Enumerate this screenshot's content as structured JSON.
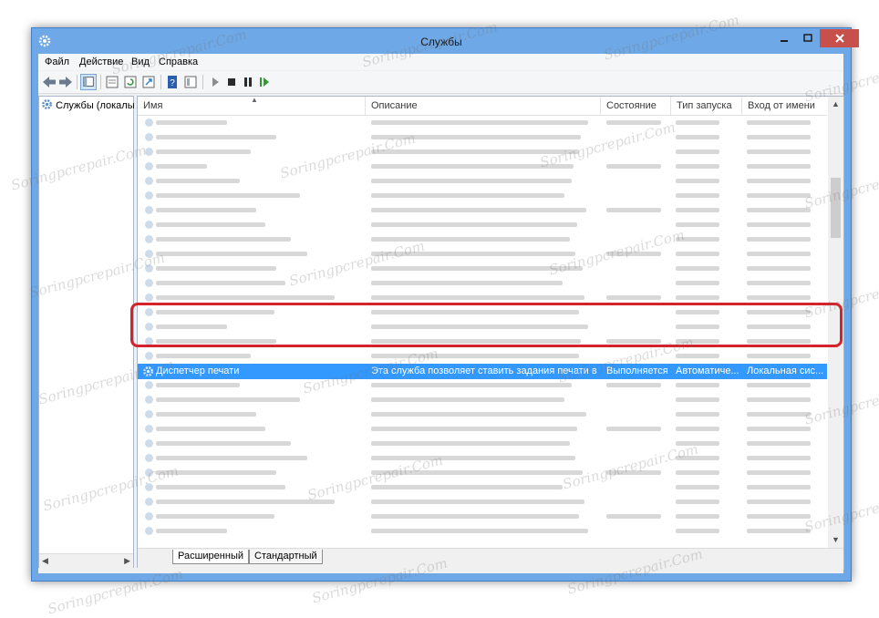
{
  "window": {
    "title": "Службы"
  },
  "menu": [
    "Файл",
    "Действие",
    "Вид",
    "Справка"
  ],
  "tree": {
    "root_label": "Службы (локалы"
  },
  "columns": [
    "Имя",
    "Описание",
    "Состояние",
    "Тип запуска",
    "Вход от имени"
  ],
  "selected_service": {
    "name": "Диспетчер печати",
    "description": "Эта служба позволяет ставить задания печати в оч...",
    "status": "Выполняется",
    "startup_type": "Автоматиче...",
    "logon_as": "Локальная сис..."
  },
  "tabs": [
    "Расширенный",
    "Стандартный"
  ],
  "watermark": "Soringpcrepair.Com",
  "icons": {
    "app": "services-gear-icon",
    "toolbar": [
      "back-arrow-icon",
      "forward-arrow-icon",
      "show-hide-tree-icon",
      "properties-icon",
      "refresh-icon",
      "export-list-icon",
      "help-icon",
      "console-tree-icon",
      "start-service-icon",
      "stop-service-icon",
      "pause-service-icon",
      "restart-service-icon"
    ]
  },
  "colors": {
    "selection": "#3399ff",
    "highlight_frame": "#d4232c",
    "window_frame": "#6fa8e6"
  }
}
